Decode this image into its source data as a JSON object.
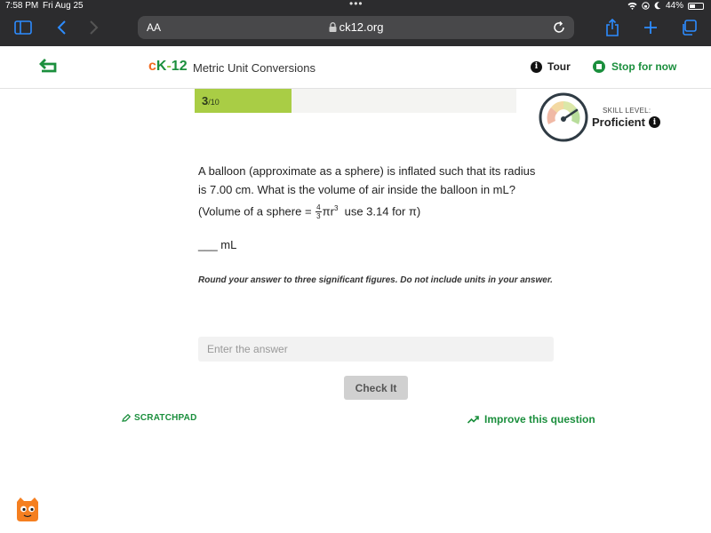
{
  "status_bar": {
    "time": "7:58 PM",
    "date": "Fri Aug 25",
    "battery": "44%"
  },
  "browser": {
    "aa_label": "AA",
    "url": "ck12.org"
  },
  "header": {
    "logo": {
      "c": "c",
      "k": "K",
      "dash": "-",
      "num": "12"
    },
    "title": "Metric Unit Conversions",
    "tour_label": "Tour",
    "info_glyph": "i",
    "stop_label": "Stop for now"
  },
  "progress": {
    "current": "3",
    "total_text": "/10",
    "fraction": 0.3
  },
  "skill": {
    "caption": "SKILL LEVEL:",
    "level": "Proficient"
  },
  "question": {
    "line1": "A balloon (approximate as a sphere) is inflated such that its radius",
    "line2": "is 7.00 cm. What is the volume of air inside the balloon in mL?",
    "formula_prefix": "(Volume of a sphere = ",
    "frac_num": "4",
    "frac_den": "3",
    "formula_pi_r": "πr",
    "formula_exp": "3",
    "formula_suffix": "  use 3.14 for π)",
    "blank": "___ mL",
    "instructions": "Round your answer to three significant figures. Do not include units in your answer."
  },
  "answer": {
    "placeholder": "Enter the answer"
  },
  "buttons": {
    "check": "Check It",
    "scratchpad": "SCRATCHPAD",
    "improve": "Improve this question"
  },
  "colors": {
    "brand_green": "#1b8f3d",
    "progress_fill": "#a9cd45",
    "ios_blue": "#2d8cff",
    "logo_orange": "#f26b21"
  }
}
